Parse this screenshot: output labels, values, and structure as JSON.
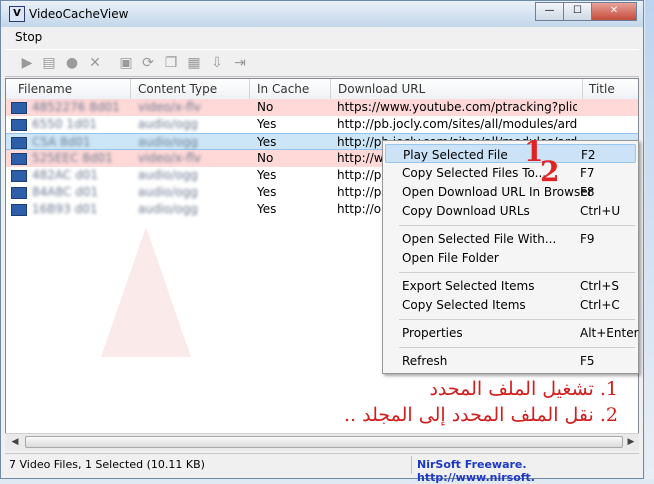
{
  "window": {
    "title": "VideoCacheView",
    "icon": "app-icon",
    "minimize": "—",
    "maximize": "☐",
    "close": "✕"
  },
  "menu": {
    "stop": "Stop"
  },
  "toolbar": {
    "icons": [
      "play-icon",
      "copy-files-icon",
      "record-icon",
      "delete-icon",
      "save-icon",
      "refresh-icon",
      "copy-icon",
      "properties-icon",
      "download-icon",
      "exit-icon"
    ]
  },
  "columns": [
    "Filename",
    "Content Type",
    "In Cache",
    "Download URL",
    "Title"
  ],
  "rows": [
    {
      "filename": "4852276 8d01",
      "type": "video/x-flv",
      "cache": "No",
      "url": "https://www.youtube.com/ptracking?plid=...",
      "state": "pink"
    },
    {
      "filename": "6550 1d01",
      "type": "audio/ogg",
      "cache": "Yes",
      "url": "http://pb.jocly.com/sites/all/modules/ardri...",
      "state": "normal"
    },
    {
      "filename": "C5A 8d01",
      "type": "audio/ogg",
      "cache": "Yes",
      "url": "http://pb.jocly.com/sites/all/modules/ardri...",
      "state": "selected"
    },
    {
      "filename": "525EEC 8d01",
      "type": "video/x-flv",
      "cache": "No",
      "url": "http://wi",
      "state": "pink"
    },
    {
      "filename": "482AC d01",
      "type": "audio/ogg",
      "cache": "Yes",
      "url": "http://pb",
      "state": "normal"
    },
    {
      "filename": "84A8C d01",
      "type": "audio/ogg",
      "cache": "Yes",
      "url": "http://pb",
      "state": "normal"
    },
    {
      "filename": "16B93 d01",
      "type": "audio/ogg",
      "cache": "Yes",
      "url": "http://o-",
      "state": "normal"
    }
  ],
  "context_menu": [
    {
      "label": "Play Selected File",
      "key": "F2",
      "highlighted": true
    },
    {
      "label": "Copy Selected Files To...",
      "key": "F7"
    },
    {
      "label": "Open Download URL In Browser",
      "key": "F8"
    },
    {
      "label": "Copy Download URLs",
      "key": "Ctrl+U"
    },
    {
      "label": "Open Selected File With...",
      "key": "F9"
    },
    {
      "label": "Open File Folder",
      "key": ""
    },
    {
      "label": "Export Selected Items",
      "key": "Ctrl+S"
    },
    {
      "label": "Copy Selected Items",
      "key": "Ctrl+C"
    },
    {
      "label": "Properties",
      "key": "Alt+Enter"
    },
    {
      "label": "Refresh",
      "key": "F5"
    }
  ],
  "annotations": {
    "num1": "1",
    "num2": "2",
    "line1": "1. تشغيل الملف المحدد",
    "line2": "2. نقل الملف المحدد إلى المجلد .."
  },
  "status": {
    "left": "7 Video Files, 1 Selected  (10.11 KB)",
    "right": "NirSoft Freeware.  http://www.nirsoft."
  },
  "colors": {
    "pink_row": "#ffd8d8",
    "selected_row": "#cde6f7",
    "annotation": "#d01e1e",
    "link": "#1c38c4"
  }
}
